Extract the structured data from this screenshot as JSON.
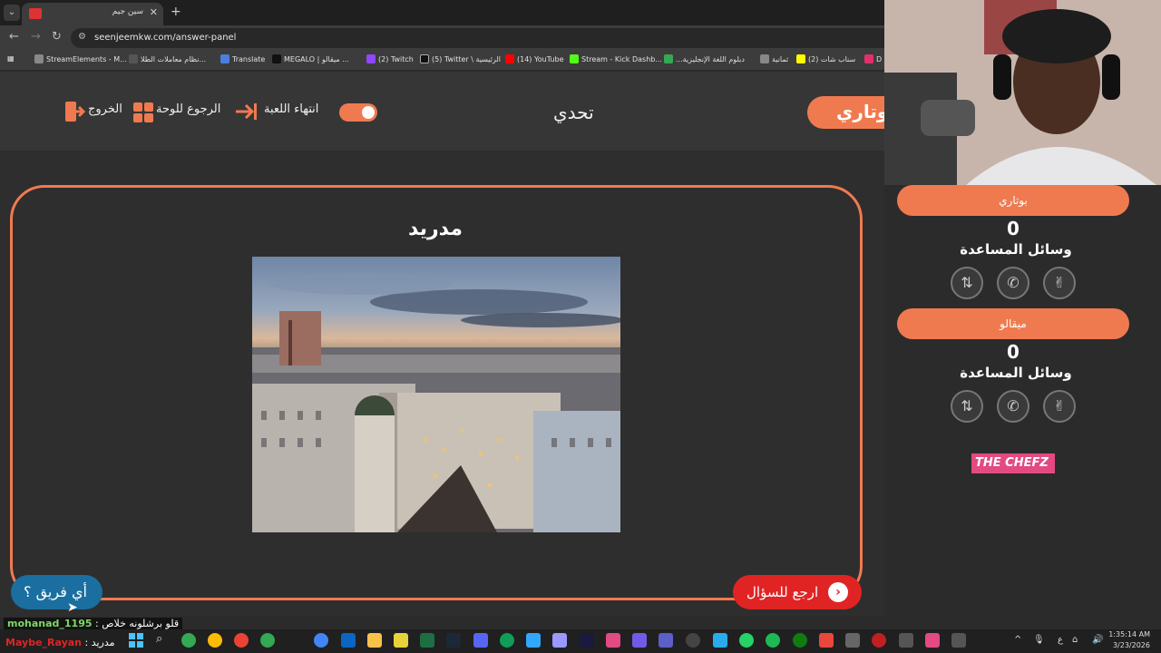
{
  "browser": {
    "tab_title": "سين جيم",
    "url": "seenjeemkw.com/answer-panel",
    "bookmarks": [
      "StreamElements - M...",
      "نظام معاملات الطلا...",
      "Translate",
      "MEGALO | ميقالو ...",
      "(2) Twitch",
      "(5) Twitter \\ الرئيسية",
      "(14) YouTube",
      "Stream - Kick Dashb...",
      "...دبلوم اللغة الإنجليزية",
      "ثمانية",
      "(2) سناب شات",
      "D"
    ]
  },
  "header": {
    "team_name": "بوتاري",
    "title": "تحدي",
    "end_game": "انتهاء اللعبة",
    "back_to_board": "الرجوع للوحة",
    "exit": "الخروج"
  },
  "answer": {
    "title": "مدريد",
    "back_to_question": "ارجع للسؤال",
    "which_team": "أي فريق ؟"
  },
  "teams": [
    {
      "name": "بوتاري",
      "score": "0",
      "aids_label": "وسائل المساعدة"
    },
    {
      "name": "ميقالو",
      "score": "0",
      "aids_label": "وسائل المساعدة"
    }
  ],
  "sponsor": "THE CHEFZ",
  "chat": [
    {
      "user": "mohanad_1195",
      "message": "قلو برشلونه خلاص"
    },
    {
      "user": "Maybe_Rayan",
      "message": "مدريد"
    }
  ],
  "taskbar": {
    "time": "1:35:14 AM",
    "date": "3/23/2026",
    "lang": "ع"
  },
  "colors": {
    "accent": "#f07a50",
    "back_button": "#e02424",
    "team_button": "#1a6fa0",
    "background": "#2b2b2b"
  }
}
